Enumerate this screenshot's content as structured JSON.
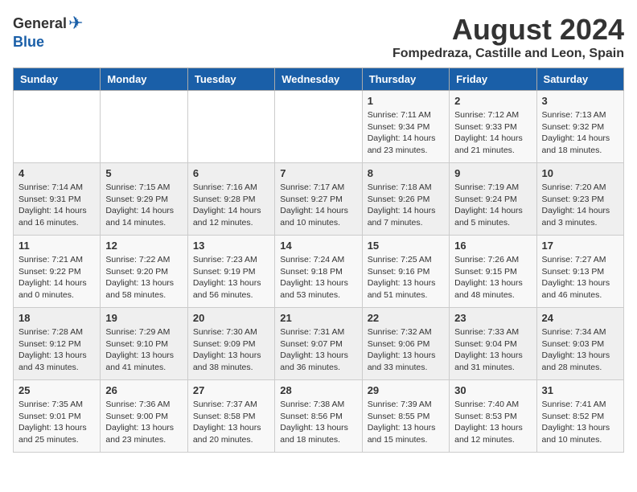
{
  "logo": {
    "general": "General",
    "blue": "Blue"
  },
  "title": "August 2024",
  "location": "Fompedraza, Castille and Leon, Spain",
  "days_of_week": [
    "Sunday",
    "Monday",
    "Tuesday",
    "Wednesday",
    "Thursday",
    "Friday",
    "Saturday"
  ],
  "weeks": [
    [
      {
        "day": "",
        "info": ""
      },
      {
        "day": "",
        "info": ""
      },
      {
        "day": "",
        "info": ""
      },
      {
        "day": "",
        "info": ""
      },
      {
        "day": "1",
        "info": "Sunrise: 7:11 AM\nSunset: 9:34 PM\nDaylight: 14 hours\nand 23 minutes."
      },
      {
        "day": "2",
        "info": "Sunrise: 7:12 AM\nSunset: 9:33 PM\nDaylight: 14 hours\nand 21 minutes."
      },
      {
        "day": "3",
        "info": "Sunrise: 7:13 AM\nSunset: 9:32 PM\nDaylight: 14 hours\nand 18 minutes."
      }
    ],
    [
      {
        "day": "4",
        "info": "Sunrise: 7:14 AM\nSunset: 9:31 PM\nDaylight: 14 hours\nand 16 minutes."
      },
      {
        "day": "5",
        "info": "Sunrise: 7:15 AM\nSunset: 9:29 PM\nDaylight: 14 hours\nand 14 minutes."
      },
      {
        "day": "6",
        "info": "Sunrise: 7:16 AM\nSunset: 9:28 PM\nDaylight: 14 hours\nand 12 minutes."
      },
      {
        "day": "7",
        "info": "Sunrise: 7:17 AM\nSunset: 9:27 PM\nDaylight: 14 hours\nand 10 minutes."
      },
      {
        "day": "8",
        "info": "Sunrise: 7:18 AM\nSunset: 9:26 PM\nDaylight: 14 hours\nand 7 minutes."
      },
      {
        "day": "9",
        "info": "Sunrise: 7:19 AM\nSunset: 9:24 PM\nDaylight: 14 hours\nand 5 minutes."
      },
      {
        "day": "10",
        "info": "Sunrise: 7:20 AM\nSunset: 9:23 PM\nDaylight: 14 hours\nand 3 minutes."
      }
    ],
    [
      {
        "day": "11",
        "info": "Sunrise: 7:21 AM\nSunset: 9:22 PM\nDaylight: 14 hours\nand 0 minutes."
      },
      {
        "day": "12",
        "info": "Sunrise: 7:22 AM\nSunset: 9:20 PM\nDaylight: 13 hours\nand 58 minutes."
      },
      {
        "day": "13",
        "info": "Sunrise: 7:23 AM\nSunset: 9:19 PM\nDaylight: 13 hours\nand 56 minutes."
      },
      {
        "day": "14",
        "info": "Sunrise: 7:24 AM\nSunset: 9:18 PM\nDaylight: 13 hours\nand 53 minutes."
      },
      {
        "day": "15",
        "info": "Sunrise: 7:25 AM\nSunset: 9:16 PM\nDaylight: 13 hours\nand 51 minutes."
      },
      {
        "day": "16",
        "info": "Sunrise: 7:26 AM\nSunset: 9:15 PM\nDaylight: 13 hours\nand 48 minutes."
      },
      {
        "day": "17",
        "info": "Sunrise: 7:27 AM\nSunset: 9:13 PM\nDaylight: 13 hours\nand 46 minutes."
      }
    ],
    [
      {
        "day": "18",
        "info": "Sunrise: 7:28 AM\nSunset: 9:12 PM\nDaylight: 13 hours\nand 43 minutes."
      },
      {
        "day": "19",
        "info": "Sunrise: 7:29 AM\nSunset: 9:10 PM\nDaylight: 13 hours\nand 41 minutes."
      },
      {
        "day": "20",
        "info": "Sunrise: 7:30 AM\nSunset: 9:09 PM\nDaylight: 13 hours\nand 38 minutes."
      },
      {
        "day": "21",
        "info": "Sunrise: 7:31 AM\nSunset: 9:07 PM\nDaylight: 13 hours\nand 36 minutes."
      },
      {
        "day": "22",
        "info": "Sunrise: 7:32 AM\nSunset: 9:06 PM\nDaylight: 13 hours\nand 33 minutes."
      },
      {
        "day": "23",
        "info": "Sunrise: 7:33 AM\nSunset: 9:04 PM\nDaylight: 13 hours\nand 31 minutes."
      },
      {
        "day": "24",
        "info": "Sunrise: 7:34 AM\nSunset: 9:03 PM\nDaylight: 13 hours\nand 28 minutes."
      }
    ],
    [
      {
        "day": "25",
        "info": "Sunrise: 7:35 AM\nSunset: 9:01 PM\nDaylight: 13 hours\nand 25 minutes."
      },
      {
        "day": "26",
        "info": "Sunrise: 7:36 AM\nSunset: 9:00 PM\nDaylight: 13 hours\nand 23 minutes."
      },
      {
        "day": "27",
        "info": "Sunrise: 7:37 AM\nSunset: 8:58 PM\nDaylight: 13 hours\nand 20 minutes."
      },
      {
        "day": "28",
        "info": "Sunrise: 7:38 AM\nSunset: 8:56 PM\nDaylight: 13 hours\nand 18 minutes."
      },
      {
        "day": "29",
        "info": "Sunrise: 7:39 AM\nSunset: 8:55 PM\nDaylight: 13 hours\nand 15 minutes."
      },
      {
        "day": "30",
        "info": "Sunrise: 7:40 AM\nSunset: 8:53 PM\nDaylight: 13 hours\nand 12 minutes."
      },
      {
        "day": "31",
        "info": "Sunrise: 7:41 AM\nSunset: 8:52 PM\nDaylight: 13 hours\nand 10 minutes."
      }
    ]
  ]
}
